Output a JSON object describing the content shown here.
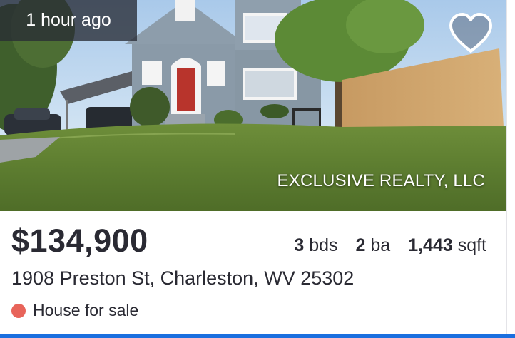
{
  "listing": {
    "time_badge": "1 hour ago",
    "brokerage": "EXCLUSIVE REALTY, LLC",
    "price": "$134,900",
    "beds": "3",
    "beds_label": "bds",
    "baths": "2",
    "baths_label": "ba",
    "sqft": "1,443",
    "sqft_label": "sqft",
    "address": "1908 Preston St, Charleston, WV 25302",
    "status": "House for sale"
  },
  "icons": {
    "favorite": "heart-icon",
    "status_dot": "status-dot-icon"
  },
  "colors": {
    "status_dot": "#e8645a",
    "accent_bar": "#1a6fdf",
    "badge_bg": "#2c3038"
  }
}
